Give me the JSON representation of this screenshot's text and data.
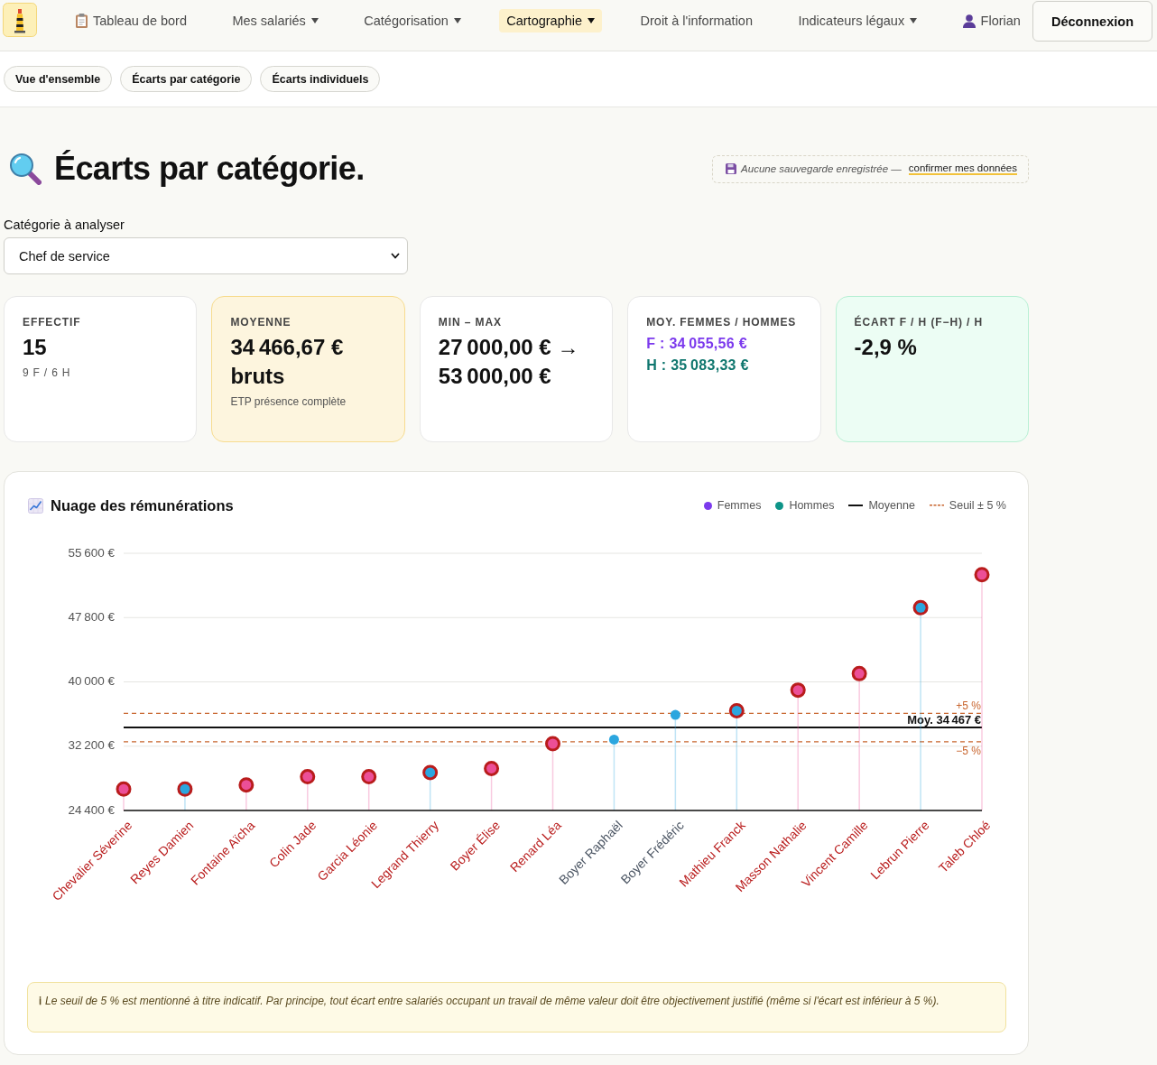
{
  "nav": {
    "items": [
      {
        "kind": "dashboard",
        "label": "Tableau de bord",
        "selected": false
      },
      {
        "kind": "menu",
        "label": "Mes salariés",
        "selected": false
      },
      {
        "kind": "menu",
        "label": "Catégorisation",
        "selected": false
      },
      {
        "kind": "menu",
        "label": "Cartographie",
        "selected": true
      },
      {
        "kind": "link",
        "label": "Droit à l'information",
        "selected": false
      },
      {
        "kind": "menu",
        "label": "Indicateurs légaux",
        "selected": false
      }
    ],
    "user": {
      "name": "Florian"
    },
    "logout": {
      "label": "Déconnexion"
    }
  },
  "subnav": [
    {
      "label": "Vue d'ensemble"
    },
    {
      "label": "Écarts par catégorie"
    },
    {
      "label": "Écarts individuels"
    }
  ],
  "page": {
    "title": "Écarts par catégorie.",
    "save_notice": {
      "text": "Aucune sauvegarde enregistrée —",
      "link": "confirmer mes données"
    }
  },
  "category": {
    "label": "Catégorie à analyser",
    "value": "Chef de service"
  },
  "cards": [
    {
      "kind": "stat",
      "color": "#ffffff",
      "label": "EFFECTIF",
      "value": "15",
      "note": "9 F / 6 H"
    },
    {
      "kind": "stat",
      "color": "#fdf5de",
      "label": "MOYENNE",
      "value": "34 466,67 € bruts",
      "note": "ETP présence complète"
    },
    {
      "kind": "stat",
      "color": "#ffffff",
      "label": "MIN – MAX",
      "value": "27 000,00 € → 53 000,00 €"
    },
    {
      "kind": "split",
      "color": "#ffffff",
      "label": "MOY. FEMMES / HOMMES",
      "lines": [
        {
          "text": "F : 34 055,56 €",
          "color": "#7c3aed"
        },
        {
          "text": "H : 35 083,33 €",
          "color": "#0f766e"
        }
      ]
    },
    {
      "kind": "stat",
      "color": "#ecfdf4",
      "label": "ÉCART F / H (F−H) / H",
      "value": "-2,9 %"
    }
  ],
  "chart": {
    "title": "Nuage des rémunérations",
    "legend": [
      {
        "kind": "dot",
        "color": "#7c3aed"
      },
      {
        "kind": "dot",
        "color": "#0d9488"
      },
      {
        "kind": "line",
        "label": "Moyenne",
        "color": "#111111"
      },
      {
        "kind": "dashed",
        "label": "Seuil ± 5 %",
        "color": "#c8652e"
      }
    ],
    "chart_data": {
      "type": "scatter",
      "categories": [
        "Chevalier Séverine",
        "Reyes Damien",
        "Fontaine Aïcha",
        "Colin Jade",
        "Garcia Léonie",
        "Legrand Thierry",
        "Boyer Élise",
        "Renard Léa",
        "Boyer Raphaël",
        "Boyer Frédéric",
        "Mathieu Franck",
        "Masson Nathalie",
        "Vincent Camille",
        "Lebrun Pierre",
        "Taleb Chloé"
      ],
      "series": [
        {
          "name": "Femmes",
          "color": "#ec4f97",
          "values": [
            27000,
            null,
            27500,
            28500,
            28500,
            null,
            29500,
            32500,
            null,
            null,
            null,
            39000,
            41000,
            null,
            53000
          ]
        },
        {
          "name": "Hommes",
          "color": "#2ba6df",
          "values": [
            null,
            27000,
            null,
            null,
            null,
            29000,
            null,
            null,
            33000,
            36000,
            36500,
            null,
            null,
            49000,
            null
          ]
        }
      ],
      "ylim": [
        24400,
        55600
      ],
      "yticks": [
        {
          "value": 24400,
          "label": "24 400 €"
        },
        {
          "value": 32200,
          "label": "32 200 €"
        },
        {
          "value": 40000,
          "label": "40 000 €"
        },
        {
          "value": 47800,
          "label": "47 800 €"
        },
        {
          "value": 55600,
          "label": "55 600 €"
        }
      ],
      "grid": true,
      "ref_lines": [
        {
          "axis": "y",
          "value": 34467,
          "label": "Moy. 34 467 €",
          "color": "#111111"
        },
        {
          "axis": "y",
          "value": 36190,
          "color": "#c8652e"
        },
        {
          "axis": "y",
          "value": 32743,
          "color": "#c8652e"
        }
      ]
    },
    "threshold_labels": [
      "+5 %",
      "−5 %"
    ],
    "note": {
      "symbol": "ℹ",
      "text": "Le seuil de 5 % est mentionné à titre indicatif. Par principe, tout écart entre salariés occupant un travail de même valeur doit être objectivement justifié (même si l'écart est inférieur à 5 %)."
    }
  }
}
